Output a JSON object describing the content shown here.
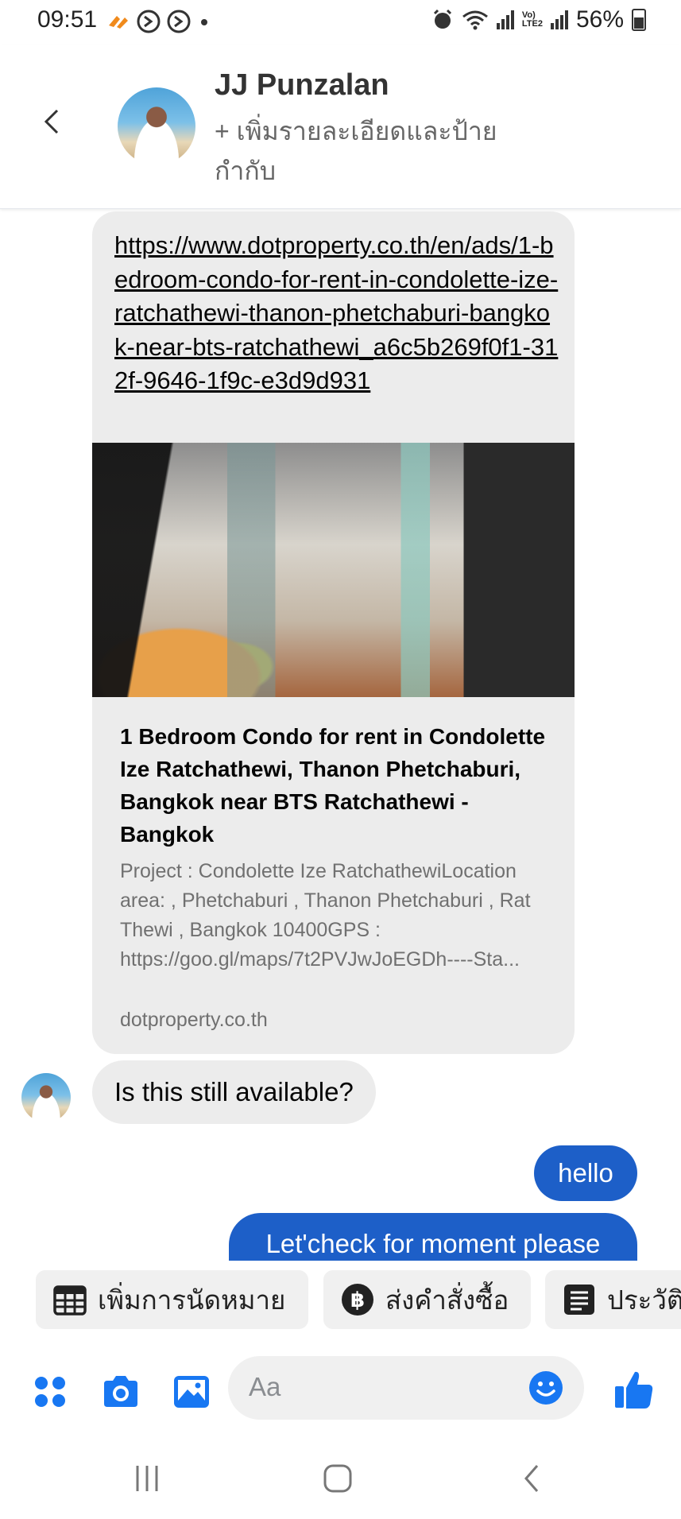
{
  "status_bar": {
    "time": "09:51",
    "volte": "Vo)\nLTE2",
    "battery": "56%"
  },
  "header": {
    "contact_name": "JJ Punzalan",
    "subtitle": "+ เพิ่มรายละเอียดและป้ายกำกับ"
  },
  "messages": {
    "link_url": "https://www.dotproperty.co.th/en/ads/1-bedroom-condo-for-rent-in-condolette-ize-ratchathewi-thanon-phetchaburi-bangkok-near-bts-ratchathewi_a6c5b269f0f1-312f-9646-1f9c-e3d9d931",
    "preview_title": "1 Bedroom Condo for rent in Condolette Ize Ratchathewi, Thanon Phetchaburi, Bangkok near BTS Ratchathewi - Bangkok",
    "preview_description": "Project : Condolette Ize RatchathewiLocation area: , Phetchaburi , Thanon Phetchaburi , Rat Thewi , Bangkok 10400GPS : https://goo.gl/maps/7t2PVJwJoEGDh----Sta...",
    "preview_domain": "dotproperty.co.th",
    "incoming_text": "Is this still available?",
    "outgoing": [
      "hello",
      "Let'check for moment please"
    ]
  },
  "quick_replies": [
    {
      "label": "เพิ่มการนัดหมาย",
      "icon": "calendar-icon"
    },
    {
      "label": "ส่งคำสั่งซื้อ",
      "icon": "baht-icon"
    },
    {
      "label": "ประวัติ",
      "icon": "list-icon"
    }
  ],
  "composer": {
    "placeholder": "Aa",
    "accent_color": "#1877f2"
  },
  "colors": {
    "outgoing_bubble": "#1d5fc8",
    "incoming_bubble": "#ececec"
  }
}
